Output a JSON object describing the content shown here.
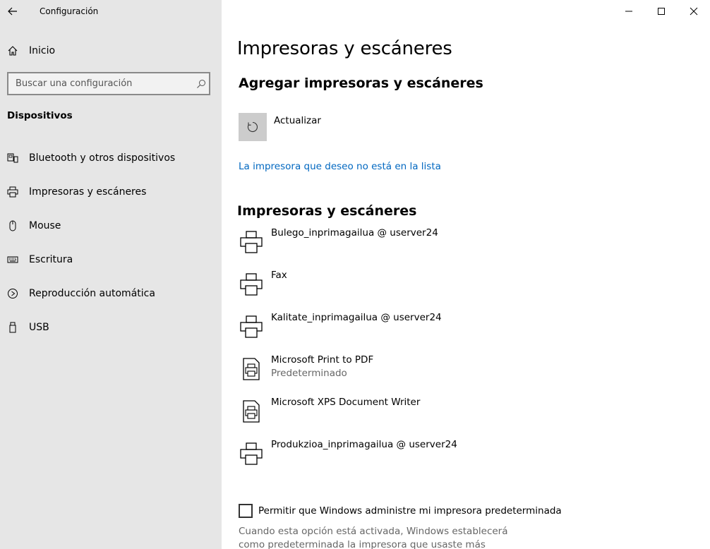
{
  "app": {
    "title": "Configuración"
  },
  "sidebar": {
    "home_label": "Inicio",
    "search_placeholder": "Buscar una configuración",
    "section_title": "Dispositivos",
    "items": [
      {
        "label": "Bluetooth y otros dispositivos",
        "icon": "bluetooth-devices-icon"
      },
      {
        "label": "Impresoras y escáneres",
        "icon": "printer-icon"
      },
      {
        "label": "Mouse",
        "icon": "mouse-icon"
      },
      {
        "label": "Escritura",
        "icon": "keyboard-icon"
      },
      {
        "label": "Reproducción automática",
        "icon": "autoplay-icon"
      },
      {
        "label": "USB",
        "icon": "usb-icon"
      }
    ]
  },
  "main": {
    "page_title": "Impresoras y escáneres",
    "add_heading": "Agregar impresoras y escáneres",
    "refresh_label": "Actualizar",
    "not_listed_link": "La impresora que deseo no está en la lista",
    "list_heading": "Impresoras y escáneres",
    "printers": [
      {
        "name": "Bulego_inprimagailua @ userver24",
        "status": "",
        "icon": "printer-icon"
      },
      {
        "name": "Fax",
        "status": "",
        "icon": "printer-icon"
      },
      {
        "name": "Kalitate_inprimagailua @ userver24",
        "status": "",
        "icon": "printer-icon"
      },
      {
        "name": "Microsoft Print to PDF",
        "status": "Predeterminado",
        "icon": "document-printer-icon"
      },
      {
        "name": "Microsoft XPS Document Writer",
        "status": "",
        "icon": "document-printer-icon"
      },
      {
        "name": "Produkzioa_inprimagailua @ userver24",
        "status": "",
        "icon": "printer-icon"
      }
    ],
    "default_checkbox_label": "Permitir que Windows administre mi impresora predeterminada",
    "default_description": "Cuando esta opción está activada, Windows establecerá como predeterminada la impresora que usaste más recientemente en la"
  },
  "colors": {
    "sidebar_bg": "#e6e6e6",
    "accent": "#0067c0",
    "tile": "#cccccc"
  }
}
